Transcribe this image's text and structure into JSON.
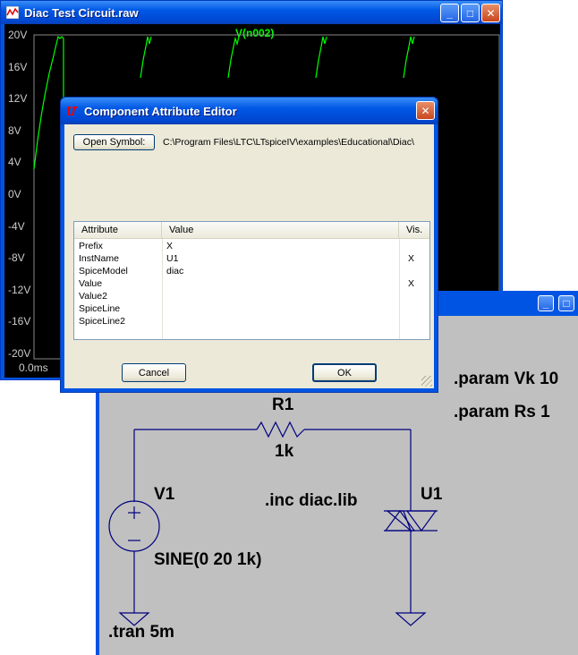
{
  "wave_window": {
    "title": "Diac Test Circuit.raw",
    "trace_name": "V(n002)",
    "y_labels": [
      "20V",
      "16V",
      "12V",
      "8V",
      "4V",
      "0V",
      "-4V",
      "-8V",
      "-12V",
      "-16V",
      "-20V"
    ],
    "x_start_label": "0.0ms",
    "trace_color": "#00ff00"
  },
  "dialog": {
    "title": "Component Attribute Editor",
    "open_symbol_label": "Open Symbol:",
    "symbol_path": "C:\\Program Files\\LTC\\LTspiceIV\\examples\\Educational\\Diac\\",
    "columns": [
      "Attribute",
      "Value",
      "Vis."
    ],
    "rows": [
      {
        "attribute": "Prefix",
        "value": "X",
        "vis": ""
      },
      {
        "attribute": "InstName",
        "value": "U1",
        "vis": "X"
      },
      {
        "attribute": "SpiceModel",
        "value": "diac",
        "vis": ""
      },
      {
        "attribute": "Value",
        "value": "",
        "vis": "X"
      },
      {
        "attribute": "Value2",
        "value": "",
        "vis": ""
      },
      {
        "attribute": "SpiceLine",
        "value": "",
        "vis": ""
      },
      {
        "attribute": "SpiceLine2",
        "value": "",
        "vis": ""
      }
    ],
    "cancel_label": "Cancel",
    "ok_label": "OK"
  },
  "schematic": {
    "param_vk": ".param Vk 10",
    "param_rs": ".param Rs 1",
    "r1_name": "R1",
    "r1_value": "1k",
    "v1_name": "V1",
    "v1_value": "SINE(0 20 1k)",
    "inc": ".inc diac.lib",
    "u1_name": "U1",
    "tran": ".tran 5m",
    "wire_color": "#00007f"
  }
}
